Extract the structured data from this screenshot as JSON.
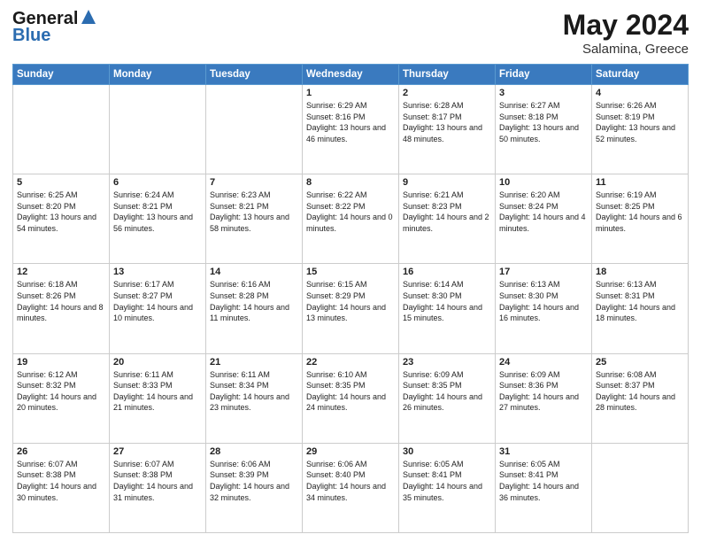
{
  "header": {
    "logo_line1": "General",
    "logo_line2": "Blue",
    "month_year": "May 2024",
    "location": "Salamina, Greece"
  },
  "days_of_week": [
    "Sunday",
    "Monday",
    "Tuesday",
    "Wednesday",
    "Thursday",
    "Friday",
    "Saturday"
  ],
  "weeks": [
    [
      {
        "day": "",
        "info": ""
      },
      {
        "day": "",
        "info": ""
      },
      {
        "day": "",
        "info": ""
      },
      {
        "day": "1",
        "info": "Sunrise: 6:29 AM\nSunset: 8:16 PM\nDaylight: 13 hours\nand 46 minutes."
      },
      {
        "day": "2",
        "info": "Sunrise: 6:28 AM\nSunset: 8:17 PM\nDaylight: 13 hours\nand 48 minutes."
      },
      {
        "day": "3",
        "info": "Sunrise: 6:27 AM\nSunset: 8:18 PM\nDaylight: 13 hours\nand 50 minutes."
      },
      {
        "day": "4",
        "info": "Sunrise: 6:26 AM\nSunset: 8:19 PM\nDaylight: 13 hours\nand 52 minutes."
      }
    ],
    [
      {
        "day": "5",
        "info": "Sunrise: 6:25 AM\nSunset: 8:20 PM\nDaylight: 13 hours\nand 54 minutes."
      },
      {
        "day": "6",
        "info": "Sunrise: 6:24 AM\nSunset: 8:21 PM\nDaylight: 13 hours\nand 56 minutes."
      },
      {
        "day": "7",
        "info": "Sunrise: 6:23 AM\nSunset: 8:21 PM\nDaylight: 13 hours\nand 58 minutes."
      },
      {
        "day": "8",
        "info": "Sunrise: 6:22 AM\nSunset: 8:22 PM\nDaylight: 14 hours\nand 0 minutes."
      },
      {
        "day": "9",
        "info": "Sunrise: 6:21 AM\nSunset: 8:23 PM\nDaylight: 14 hours\nand 2 minutes."
      },
      {
        "day": "10",
        "info": "Sunrise: 6:20 AM\nSunset: 8:24 PM\nDaylight: 14 hours\nand 4 minutes."
      },
      {
        "day": "11",
        "info": "Sunrise: 6:19 AM\nSunset: 8:25 PM\nDaylight: 14 hours\nand 6 minutes."
      }
    ],
    [
      {
        "day": "12",
        "info": "Sunrise: 6:18 AM\nSunset: 8:26 PM\nDaylight: 14 hours\nand 8 minutes."
      },
      {
        "day": "13",
        "info": "Sunrise: 6:17 AM\nSunset: 8:27 PM\nDaylight: 14 hours\nand 10 minutes."
      },
      {
        "day": "14",
        "info": "Sunrise: 6:16 AM\nSunset: 8:28 PM\nDaylight: 14 hours\nand 11 minutes."
      },
      {
        "day": "15",
        "info": "Sunrise: 6:15 AM\nSunset: 8:29 PM\nDaylight: 14 hours\nand 13 minutes."
      },
      {
        "day": "16",
        "info": "Sunrise: 6:14 AM\nSunset: 8:30 PM\nDaylight: 14 hours\nand 15 minutes."
      },
      {
        "day": "17",
        "info": "Sunrise: 6:13 AM\nSunset: 8:30 PM\nDaylight: 14 hours\nand 16 minutes."
      },
      {
        "day": "18",
        "info": "Sunrise: 6:13 AM\nSunset: 8:31 PM\nDaylight: 14 hours\nand 18 minutes."
      }
    ],
    [
      {
        "day": "19",
        "info": "Sunrise: 6:12 AM\nSunset: 8:32 PM\nDaylight: 14 hours\nand 20 minutes."
      },
      {
        "day": "20",
        "info": "Sunrise: 6:11 AM\nSunset: 8:33 PM\nDaylight: 14 hours\nand 21 minutes."
      },
      {
        "day": "21",
        "info": "Sunrise: 6:11 AM\nSunset: 8:34 PM\nDaylight: 14 hours\nand 23 minutes."
      },
      {
        "day": "22",
        "info": "Sunrise: 6:10 AM\nSunset: 8:35 PM\nDaylight: 14 hours\nand 24 minutes."
      },
      {
        "day": "23",
        "info": "Sunrise: 6:09 AM\nSunset: 8:35 PM\nDaylight: 14 hours\nand 26 minutes."
      },
      {
        "day": "24",
        "info": "Sunrise: 6:09 AM\nSunset: 8:36 PM\nDaylight: 14 hours\nand 27 minutes."
      },
      {
        "day": "25",
        "info": "Sunrise: 6:08 AM\nSunset: 8:37 PM\nDaylight: 14 hours\nand 28 minutes."
      }
    ],
    [
      {
        "day": "26",
        "info": "Sunrise: 6:07 AM\nSunset: 8:38 PM\nDaylight: 14 hours\nand 30 minutes."
      },
      {
        "day": "27",
        "info": "Sunrise: 6:07 AM\nSunset: 8:38 PM\nDaylight: 14 hours\nand 31 minutes."
      },
      {
        "day": "28",
        "info": "Sunrise: 6:06 AM\nSunset: 8:39 PM\nDaylight: 14 hours\nand 32 minutes."
      },
      {
        "day": "29",
        "info": "Sunrise: 6:06 AM\nSunset: 8:40 PM\nDaylight: 14 hours\nand 34 minutes."
      },
      {
        "day": "30",
        "info": "Sunrise: 6:05 AM\nSunset: 8:41 PM\nDaylight: 14 hours\nand 35 minutes."
      },
      {
        "day": "31",
        "info": "Sunrise: 6:05 AM\nSunset: 8:41 PM\nDaylight: 14 hours\nand 36 minutes."
      },
      {
        "day": "",
        "info": ""
      }
    ]
  ]
}
